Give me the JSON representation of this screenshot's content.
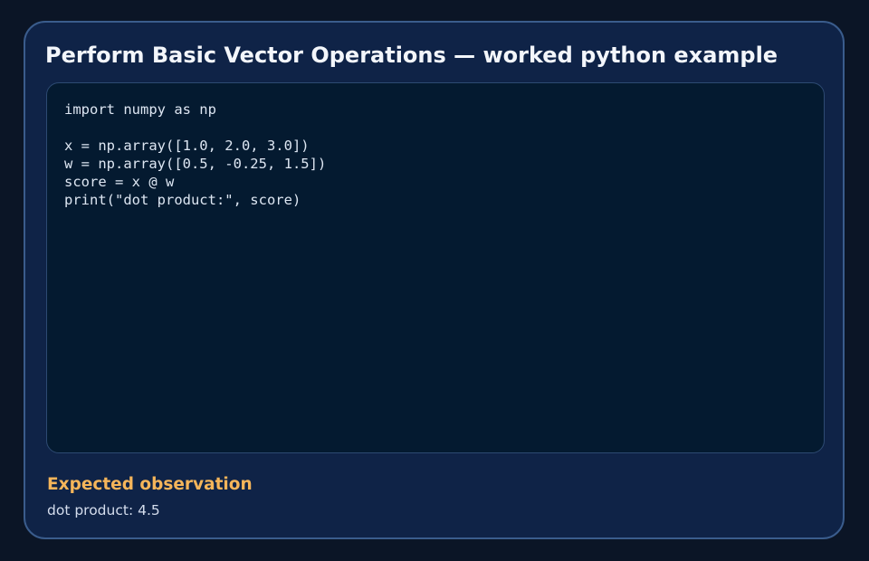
{
  "card": {
    "title": "Perform Basic Vector Operations — worked python example",
    "code": "import numpy as np\n\nx = np.array([1.0, 2.0, 3.0])\nw = np.array([0.5, -0.25, 1.5])\nscore = x @ w\nprint(\"dot product:\", score)",
    "observation": {
      "heading": "Expected observation",
      "text": "dot product: 4.5"
    }
  },
  "colors": {
    "page_background": "#0b1526",
    "card_background": "#0f2347",
    "card_border": "#3a5c8c",
    "code_background": "#041a30",
    "title_text": "#f3f6fb",
    "code_text": "#dde6f2",
    "observation_heading": "#f5b55a",
    "observation_text": "#d4dded"
  }
}
